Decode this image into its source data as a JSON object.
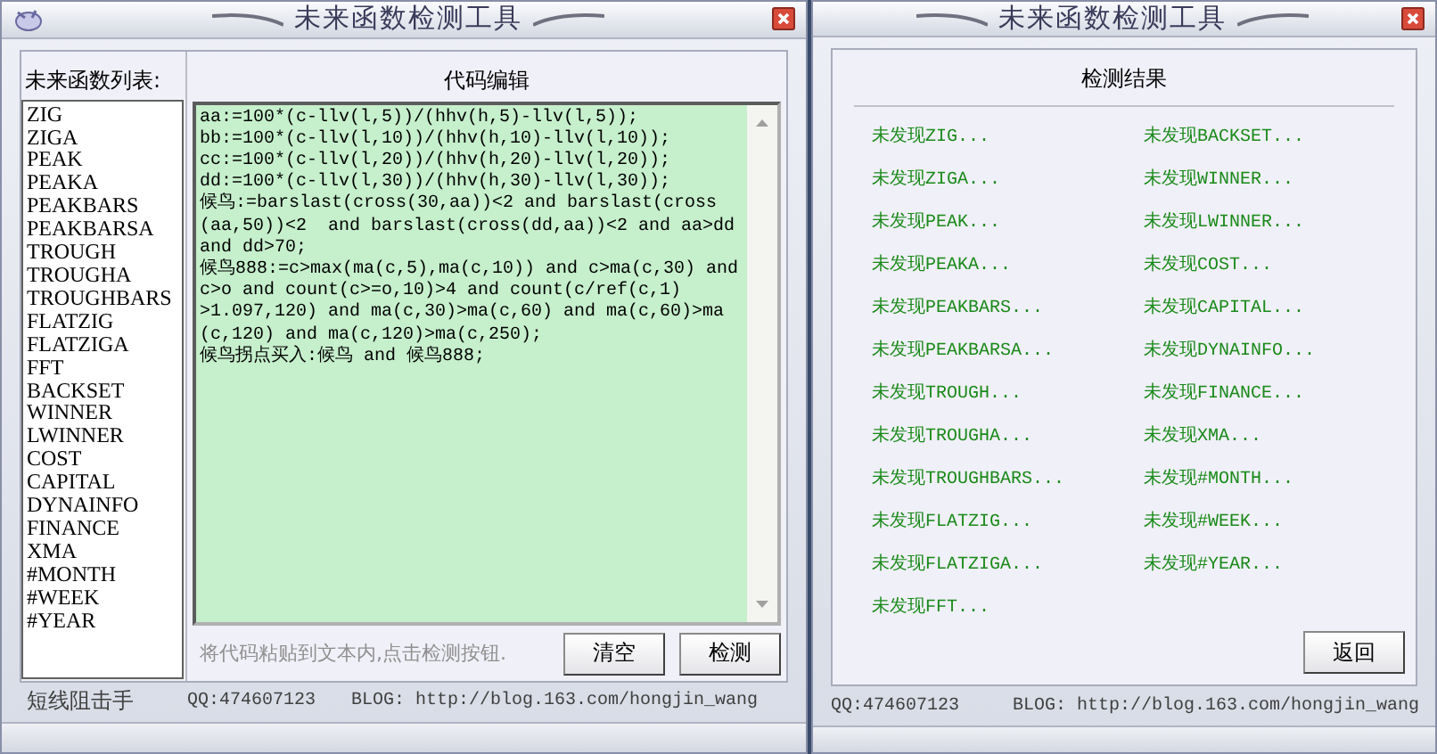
{
  "windows": [
    {
      "title": "未来函数检测工具",
      "kind": "editor",
      "list_header": "未来函数列表:",
      "functions": [
        "ZIG",
        "ZIGA",
        "PEAK",
        "PEAKA",
        "PEAKBARS",
        "PEAKBARSA",
        "TROUGH",
        "TROUGHA",
        "TROUGHBARS",
        "FLATZIG",
        "FLATZIGA",
        "FFT",
        "BACKSET",
        "WINNER",
        "LWINNER",
        "COST",
        "CAPITAL",
        "DYNAINFO",
        "FINANCE",
        "XMA",
        "#MONTH",
        "#WEEK",
        "#YEAR"
      ],
      "editor_header": "代码编辑",
      "code_lines": [
        "aa:=100*(c-llv(l,5))/(hhv(h,5)-llv(l,5));",
        "bb:=100*(c-llv(l,10))/(hhv(h,10)-llv(l,10));",
        "cc:=100*(c-llv(l,20))/(hhv(h,20)-llv(l,20));",
        "dd:=100*(c-llv(l,30))/(hhv(h,30)-llv(l,30));",
        "候鸟:=barslast(cross(30,aa))<2 and barslast(cross",
        "(aa,50))<2  and barslast(cross(dd,aa))<2 and aa>dd",
        "and dd>70;",
        "候鸟888:=c>max(ma(c,5),ma(c,10)) and c>ma(c,30) and",
        "c>o and count(c>=o,10)>4 and count(c/ref(c,1)",
        ">1.097,120) and ma(c,30)>ma(c,60) and ma(c,60)>ma",
        "(c,120) and ma(c,120)>ma(c,250);",
        "候鸟拐点买入:候鸟 and 候鸟888;"
      ],
      "hint": "将代码粘贴到文本内,点击检测按钮.",
      "buttons": [
        "清空",
        "检测"
      ],
      "status": [
        "短线阻击手",
        "QQ:474607123",
        "BLOG: http://blog.163.com/hongjin_wang"
      ]
    },
    {
      "title": "未来函数检测工具",
      "kind": "results",
      "results_header": "检测结果",
      "results_left": [
        "未发现ZIG...",
        "未发现ZIGA...",
        "未发现PEAK...",
        "未发现PEAKA...",
        "未发现PEAKBARS...",
        "未发现PEAKBARSA...",
        "未发现TROUGH...",
        "未发现TROUGHA...",
        "未发现TROUGHBARS...",
        "未发现FLATZIG...",
        "未发现FLATZIGA...",
        "未发现FFT..."
      ],
      "results_right": [
        "未发现BACKSET...",
        "未发现WINNER...",
        "未发现LWINNER...",
        "未发现COST...",
        "未发现CAPITAL...",
        "未发现DYNAINFO...",
        "未发现FINANCE...",
        "未发现XMA...",
        "未发现#MONTH...",
        "未发现#WEEK...",
        "未发现#YEAR..."
      ],
      "buttons": [
        "返回"
      ],
      "status": [
        "QQ:474607123",
        "BLOG: http://blog.163.com/hongjin_wang"
      ]
    }
  ]
}
